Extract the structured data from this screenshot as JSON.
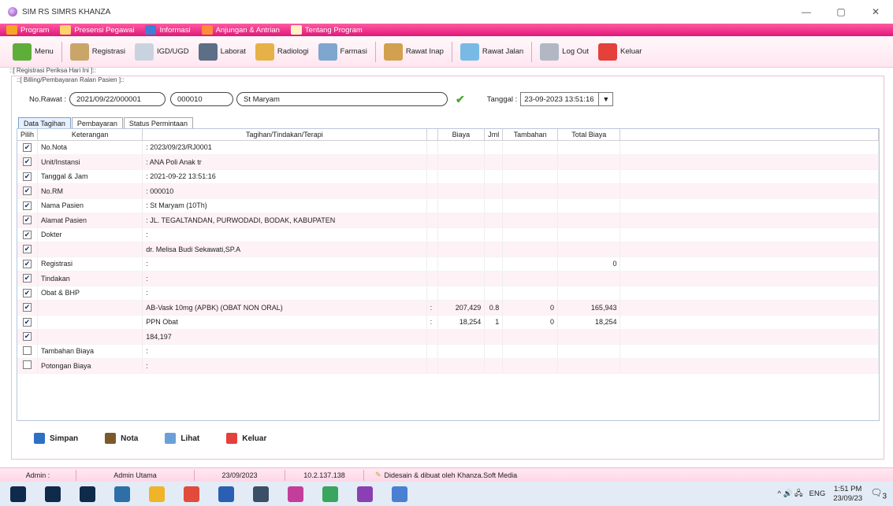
{
  "window": {
    "title": "SIM RS SIMRS KHANZA",
    "controls": [
      "—",
      "▢",
      "✕"
    ]
  },
  "menubar": {
    "items": [
      {
        "label": "Program",
        "icon": "key-icon",
        "color": "#f5a623"
      },
      {
        "label": "Presensi Pegawai",
        "icon": "person-icon",
        "color": "#ffd36b"
      },
      {
        "label": "Informasi",
        "icon": "bar-chart-icon",
        "color": "#3e7fd6"
      },
      {
        "label": "Anjungan & Antrian",
        "icon": "people-icon",
        "color": "#ff8c3a"
      },
      {
        "label": "Tentang Program",
        "icon": "document-icon",
        "color": "#fff3c2"
      }
    ]
  },
  "toolbar": {
    "items": [
      {
        "label": "Menu",
        "icon": "house-icon",
        "color": "#5fae3a"
      },
      {
        "label": "Registrasi",
        "icon": "clipboard-icon",
        "color": "#c9a56a"
      },
      {
        "label": "IGD/UGD",
        "icon": "ambulance-icon",
        "color": "#c9d3df"
      },
      {
        "label": "Laborat",
        "icon": "microscope-icon",
        "color": "#5c6f86"
      },
      {
        "label": "Radiologi",
        "icon": "xray-icon",
        "color": "#e6b248"
      },
      {
        "label": "Farmasi",
        "icon": "pharmacy-icon",
        "color": "#7fa6cf"
      },
      {
        "label": "Rawat Inap",
        "icon": "bed-icon",
        "color": "#d2a04f"
      },
      {
        "label": "Rawat Jalan",
        "icon": "walk-icon",
        "color": "#79b9e6"
      },
      {
        "label": "Log Out",
        "icon": "logout-icon",
        "color": "#b1b8c4"
      },
      {
        "label": "Keluar",
        "icon": "exit-icon",
        "color": "#e3413a"
      }
    ]
  },
  "frame": {
    "outer_title": "::[ Registrasi Periksa Hari Ini ]::",
    "inner_title": "::[ Billing/Pembayaran Ralan Pasien ]::"
  },
  "form": {
    "no_rawat_label": "No.Rawat :",
    "no_rawat": "2021/09/22/000001",
    "no_rm": "000010",
    "nama": "St Maryam",
    "tanggal_label": "Tanggal :",
    "tanggal": "23-09-2023 13:51:16"
  },
  "tabs": [
    "Data Tagihan",
    "Pembayaran",
    "Status Permintaan"
  ],
  "grid": {
    "headers": [
      "Pilih",
      "Keterangan",
      "Tagihan/Tindakan/Terapi",
      "",
      "Biaya",
      "Jml",
      "Tambahan",
      "Total Biaya"
    ],
    "rows": [
      {
        "checked": true,
        "ket": "No.Nota",
        "tagihan": ": 2023/09/23/RJ0001",
        "sep": "",
        "biaya": "",
        "jml": "",
        "tambahan": "",
        "total": ""
      },
      {
        "checked": true,
        "ket": "Unit/Instansi",
        "tagihan": ": ANA Poli Anak tr",
        "sep": "",
        "biaya": "",
        "jml": "",
        "tambahan": "",
        "total": ""
      },
      {
        "checked": true,
        "ket": "Tanggal & Jam",
        "tagihan": ": 2021-09-22 13:51:16",
        "sep": "",
        "biaya": "",
        "jml": "",
        "tambahan": "",
        "total": ""
      },
      {
        "checked": true,
        "ket": "No.RM",
        "tagihan": ": 000010",
        "sep": "",
        "biaya": "",
        "jml": "",
        "tambahan": "",
        "total": ""
      },
      {
        "checked": true,
        "ket": "Nama Pasien",
        "tagihan": ": St Maryam (10Th)",
        "sep": "",
        "biaya": "",
        "jml": "",
        "tambahan": "",
        "total": ""
      },
      {
        "checked": true,
        "ket": "Alamat Pasien",
        "tagihan": ": JL. TEGALTANDAN, PURWODADI, BODAK, KABUPATEN",
        "sep": "",
        "biaya": "",
        "jml": "",
        "tambahan": "",
        "total": ""
      },
      {
        "checked": true,
        "ket": "Dokter",
        "tagihan": ":",
        "sep": "",
        "biaya": "",
        "jml": "",
        "tambahan": "",
        "total": ""
      },
      {
        "checked": true,
        "ket": "",
        "tagihan": "dr. Melisa Budi Sekawati,SP.A",
        "sep": "",
        "biaya": "",
        "jml": "",
        "tambahan": "",
        "total": ""
      },
      {
        "checked": true,
        "ket": "Registrasi",
        "tagihan": ":",
        "sep": "",
        "biaya": "",
        "jml": "",
        "tambahan": "",
        "total": "0"
      },
      {
        "checked": true,
        "ket": "Tindakan",
        "tagihan": ":",
        "sep": "",
        "biaya": "",
        "jml": "",
        "tambahan": "",
        "total": ""
      },
      {
        "checked": true,
        "ket": "Obat & BHP",
        "tagihan": ":",
        "sep": "",
        "biaya": "",
        "jml": "",
        "tambahan": "",
        "total": ""
      },
      {
        "checked": true,
        "ket": "",
        "tagihan": "AB-Vask 10mg (APBK) (OBAT NON ORAL)",
        "sep": ":",
        "biaya": "207,429",
        "jml": "0.8",
        "tambahan": "0",
        "total": "165,943"
      },
      {
        "checked": true,
        "ket": "",
        "tagihan": "PPN Obat",
        "sep": ":",
        "biaya": "18,254",
        "jml": "1",
        "tambahan": "0",
        "total": "18,254"
      },
      {
        "checked": true,
        "ket": "",
        "tagihan": "184,197",
        "sep": "",
        "biaya": "",
        "jml": "",
        "tambahan": "",
        "total": ""
      },
      {
        "checked": false,
        "ket": "Tambahan Biaya",
        "tagihan": ":",
        "sep": "",
        "biaya": "",
        "jml": "",
        "tambahan": "",
        "total": ""
      },
      {
        "checked": false,
        "ket": "Potongan Biaya",
        "tagihan": ":",
        "sep": "",
        "biaya": "",
        "jml": "",
        "tambahan": "",
        "total": ""
      }
    ]
  },
  "actions": [
    {
      "label": "Simpan",
      "icon": "save-icon",
      "color": "#2f6fc4"
    },
    {
      "label": "Nota",
      "icon": "book-icon",
      "color": "#7b5a2a"
    },
    {
      "label": "Lihat",
      "icon": "search-icon",
      "color": "#6aa0d8"
    },
    {
      "label": "Keluar",
      "icon": "exit-icon",
      "color": "#e3413a"
    }
  ],
  "statusbar": {
    "user_label": "Admin :",
    "user": "Admin Utama",
    "date": "23/09/2023",
    "ip": "10.2.137.138",
    "credit": "Didesain & dibuat oleh Khanza.Soft Media"
  },
  "taskbar": {
    "icons": [
      {
        "name": "windows-start-icon",
        "color": "#0f2a4a"
      },
      {
        "name": "search-icon",
        "color": "#0f2a4a"
      },
      {
        "name": "task-view-icon",
        "color": "#0f2a4a"
      },
      {
        "name": "calculator-icon",
        "color": "#2e6fa8"
      },
      {
        "name": "file-explorer-icon",
        "color": "#f0b429"
      },
      {
        "name": "chrome-icon",
        "color": "#e24a3b"
      },
      {
        "name": "word-icon",
        "color": "#2b5fb3"
      },
      {
        "name": "screenshot-icon",
        "color": "#3b4f66"
      },
      {
        "name": "pen-icon",
        "color": "#c23e9a"
      },
      {
        "name": "chrome-profile-icon",
        "color": "#3aa55f"
      },
      {
        "name": "app-icon",
        "color": "#8a3fb3"
      },
      {
        "name": "chrome-alt-icon",
        "color": "#4a7fd3"
      }
    ],
    "tray_symbols": "^ 🔊 🖧",
    "lang": "ENG",
    "time": "1:51 PM",
    "date": "23/09/23",
    "notifications": "3"
  }
}
